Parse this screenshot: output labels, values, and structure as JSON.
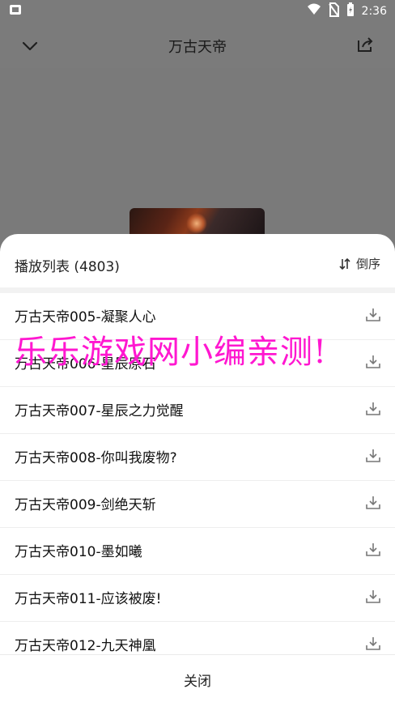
{
  "status": {
    "time": "2:36"
  },
  "header": {
    "title": "万古天帝"
  },
  "playlist": {
    "title": "播放列表 (4803)",
    "sort_label": "倒序",
    "items": [
      {
        "label": "万古天帝005-凝聚人心"
      },
      {
        "label": "万古天帝006-星辰原石"
      },
      {
        "label": "万古天帝007-星辰之力觉醒"
      },
      {
        "label": "万古天帝008-你叫我废物?"
      },
      {
        "label": "万古天帝009-剑绝天斩"
      },
      {
        "label": "万古天帝010-墨如曦"
      },
      {
        "label": "万古天帝011-应该被废!"
      },
      {
        "label": "万古天帝012-九天神凰"
      }
    ]
  },
  "footer": {
    "close_label": "关闭"
  },
  "watermark": {
    "text": "乐乐游戏网小编亲测!"
  },
  "colors": {
    "watermark": "#ff17d0",
    "overlay": "#7a7a7a"
  }
}
